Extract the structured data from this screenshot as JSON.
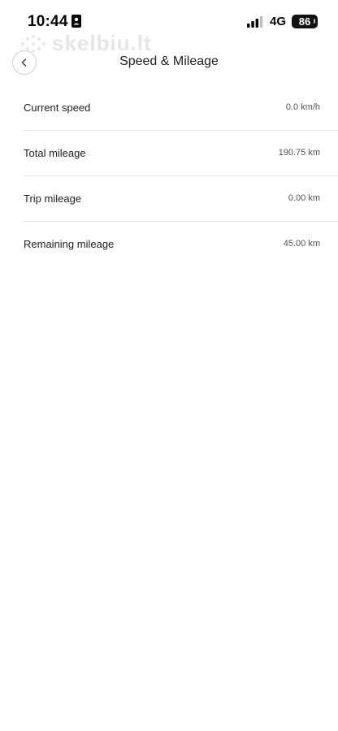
{
  "status_bar": {
    "time": "10:44",
    "network": "4G",
    "battery": "86"
  },
  "watermark": {
    "text": "skelbiu.lt"
  },
  "header": {
    "title": "Speed & Mileage",
    "back_icon": "chevron-left-icon"
  },
  "rows": [
    {
      "label": "Current speed",
      "value": "0.0 km/h"
    },
    {
      "label": "Total mileage",
      "value": "190.75 km"
    },
    {
      "label": "Trip mileage",
      "value": "0.00 km"
    },
    {
      "label": "Remaining mileage",
      "value": "45.00 km"
    }
  ],
  "colors": {
    "background": "#ffffff",
    "divider": "#e2e2e2",
    "text": "#222222"
  }
}
